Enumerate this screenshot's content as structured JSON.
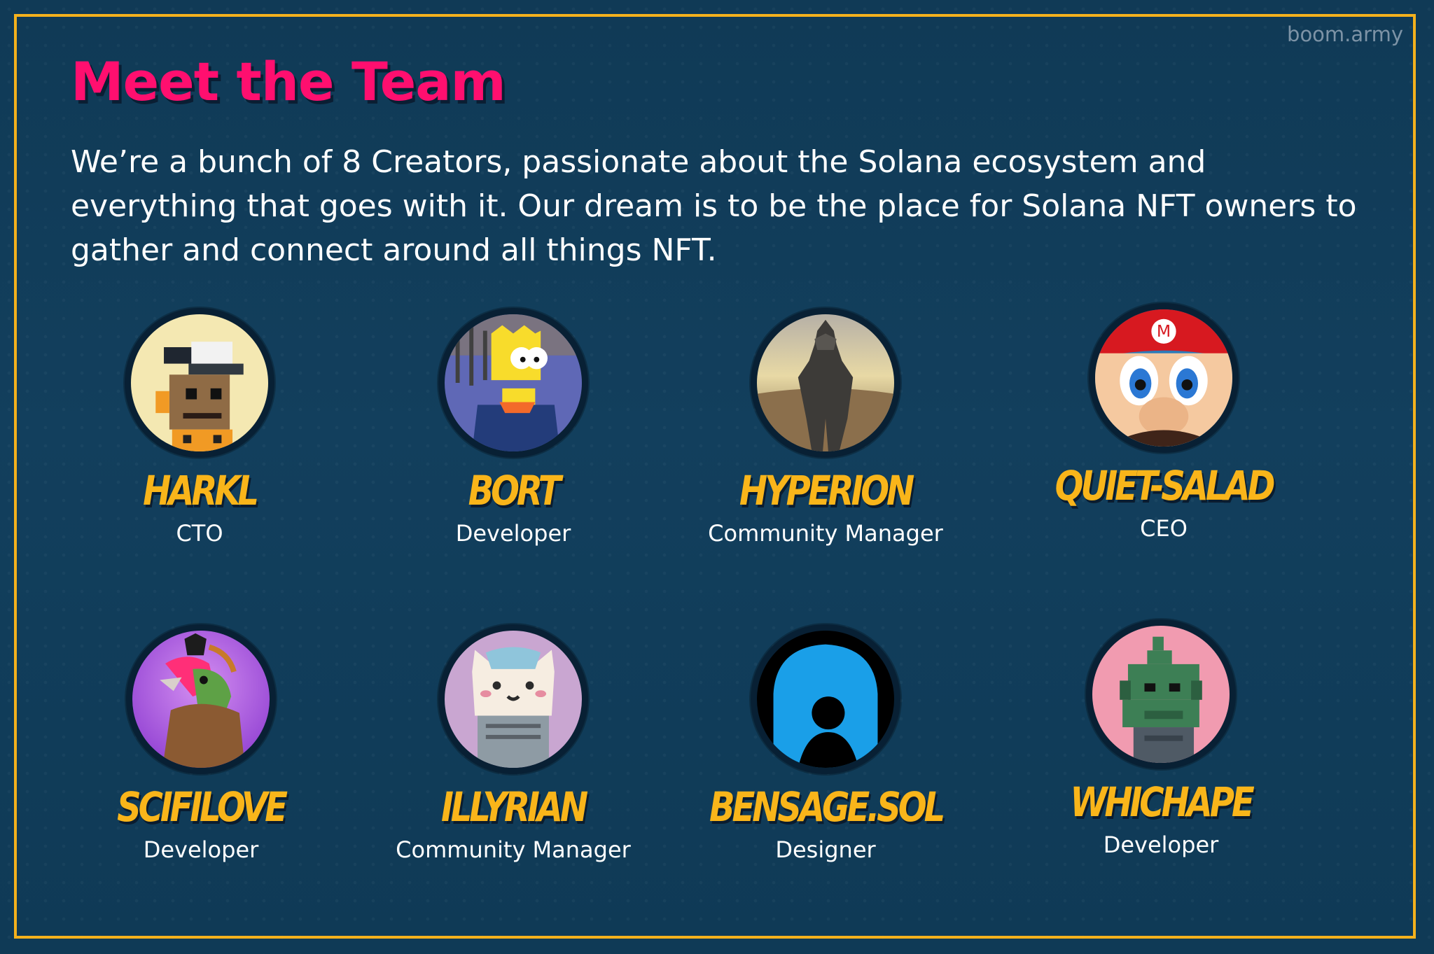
{
  "site": {
    "brand": "boom.army"
  },
  "header": {
    "title": "Meet the Team",
    "intro": "We’re a bunch of 8 Creators, passionate about the Solana ecosystem and everything that goes with it. Our dream is to be the place for Solana NFT owners to gather and connect around all things NFT."
  },
  "team": [
    {
      "name": "HARKL",
      "role": "CTO",
      "avatar_icon": "pixel-cap-avatar-icon"
    },
    {
      "name": "BORT",
      "role": "Developer",
      "avatar_icon": "cartoon-kid-avatar-icon"
    },
    {
      "name": "HYPERION",
      "role": "Community Manager",
      "avatar_icon": "armored-knight-avatar-icon"
    },
    {
      "name": "QUIET-SALAD",
      "role": "CEO",
      "avatar_icon": "red-cap-plumber-avatar-icon"
    },
    {
      "name": "SCIFILOVE",
      "role": "Developer",
      "avatar_icon": "rooster-dragon-avatar-icon"
    },
    {
      "name": "ILLYRIAN",
      "role": "Community Manager",
      "avatar_icon": "cat-avatar-icon"
    },
    {
      "name": "BENSAGE.SOL",
      "role": "Designer",
      "avatar_icon": "silhouette-avatar-icon"
    },
    {
      "name": "WHICHAPE",
      "role": "Developer",
      "avatar_icon": "pixel-ape-avatar-icon"
    }
  ],
  "colors": {
    "frame": "#f4b11d",
    "title": "#ff0f6f",
    "name": "#f9b51a",
    "text": "#ffffff"
  }
}
